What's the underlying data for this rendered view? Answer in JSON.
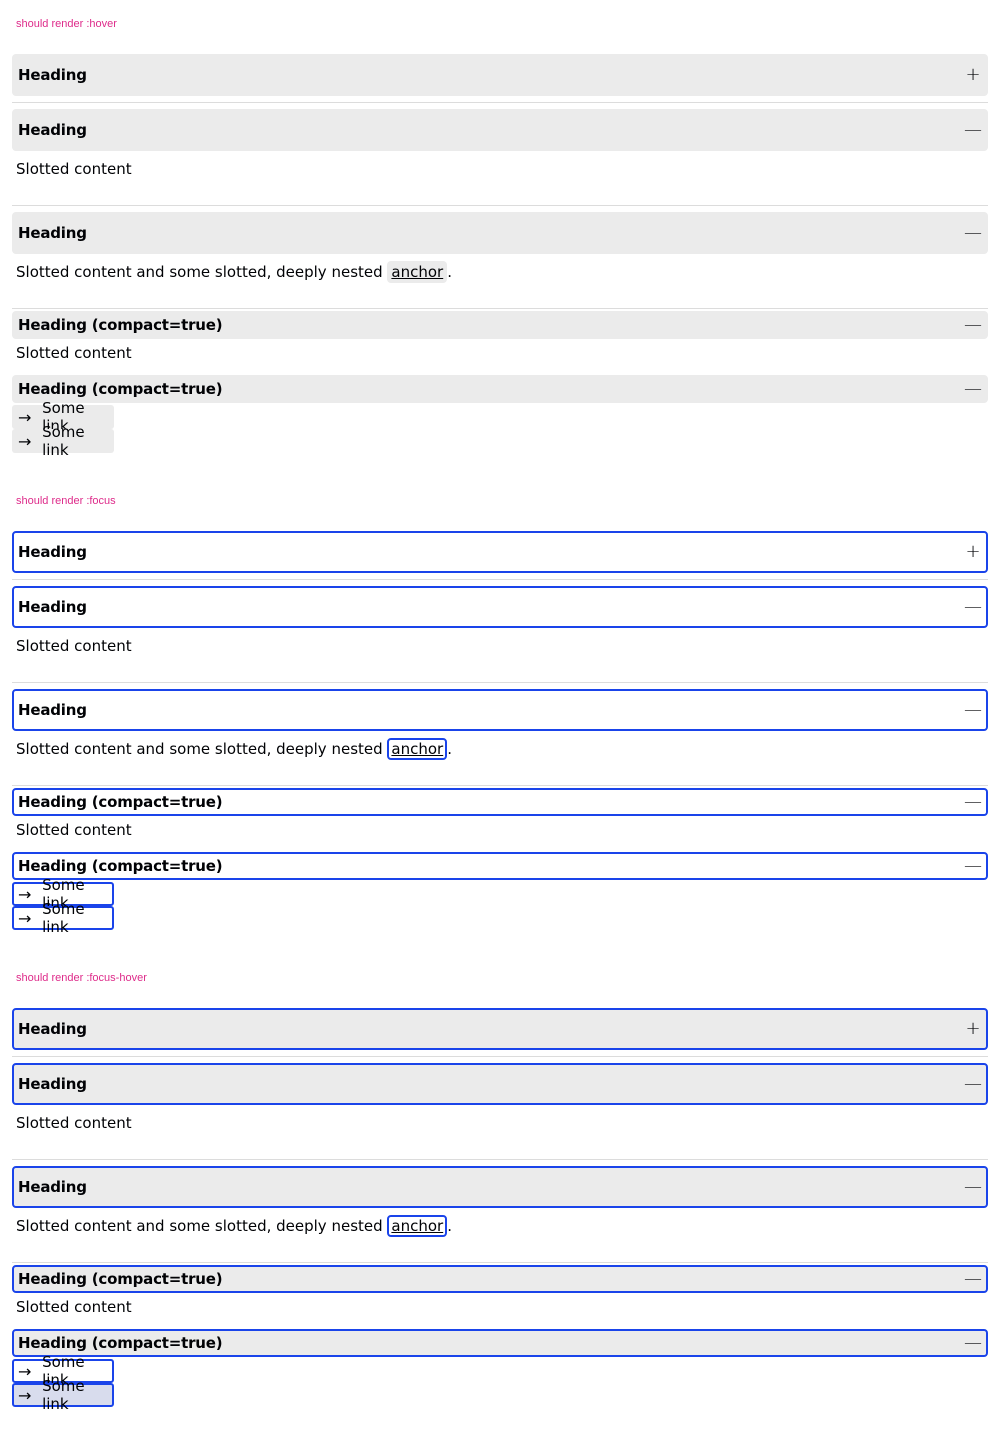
{
  "sections": [
    {
      "title": "should render :hover"
    },
    {
      "title": "should render :focus"
    },
    {
      "title": "should render :focus-hover"
    }
  ],
  "accordion": {
    "heading": "Heading",
    "heading_compact": "Heading (compact=true)",
    "content": "Slotted content",
    "content_nested_prefix": "Slotted content and some slotted, deeply nested ",
    "anchor_text": "anchor",
    "content_nested_suffix": ".",
    "link_text": "Some link",
    "icon_plus": "+",
    "icon_minus": "—",
    "icon_arrow": "→"
  },
  "colors": {
    "focus": "#1a44ea",
    "hover_bg": "#ebebeb",
    "title": "#de2b8a"
  }
}
